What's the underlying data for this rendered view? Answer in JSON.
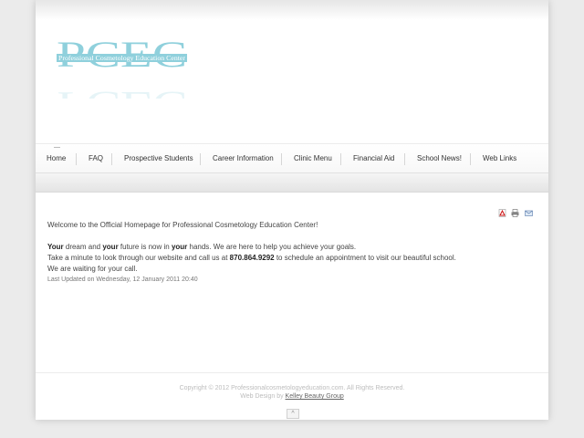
{
  "logo": {
    "letters": "PCEC",
    "tagline": "Professional Cosmetology Education Center",
    "color": "#8fd0dc"
  },
  "nav": {
    "items": [
      {
        "label": "Home"
      },
      {
        "label": "FAQ"
      },
      {
        "label": "Prospective Students"
      },
      {
        "label": "Career Information"
      },
      {
        "label": "Clinic Menu"
      },
      {
        "label": "Financial Aid"
      },
      {
        "label": "School News!"
      },
      {
        "label": "Web Links"
      }
    ]
  },
  "tools": {
    "pdf_icon": "pdf-icon",
    "print_icon": "print-icon",
    "email_icon": "email-icon"
  },
  "article": {
    "welcome": "Welcome to the Official Homepage for Professional Cosmetology Education Center!",
    "line1": {
      "w1": "Your",
      "t1": " dream and ",
      "w2": "your",
      "t2": " future is now in ",
      "w3": "your",
      "t3": " hands.  We are here to help you achieve your goals."
    },
    "line2": {
      "pre": "Take a minute to look through our website and call us at ",
      "phone": "870.864.9292",
      "post": " to schedule an appointment to visit our beautiful school."
    },
    "line3": "We are waiting for your call.",
    "updated": "Last Updated on Wednesday, 12 January 2011 20:40"
  },
  "footer": {
    "copyright": "Copyright © 2012 Professionalcosmetologyeducation.com. All Rights Reserved.",
    "design_prefix": "Web Design by ",
    "design_link": "Kelley Beauty Group"
  },
  "totop": {
    "label": "^"
  }
}
